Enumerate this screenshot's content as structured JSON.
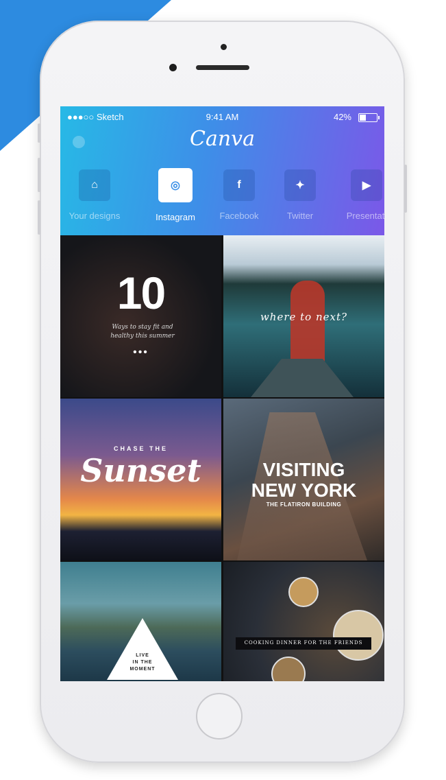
{
  "status_bar": {
    "carrier": "●●●○○ Sketch",
    "time": "9:41 AM",
    "battery": "42%",
    "battery_level": 0.42
  },
  "app": {
    "logo": "Canva"
  },
  "tabs": [
    {
      "label": "Your designs",
      "icon": "home-icon",
      "glyph": "⌂"
    },
    {
      "label": "Instagram",
      "icon": "instagram-icon",
      "glyph": "◎"
    },
    {
      "label": "Facebook",
      "icon": "facebook-icon",
      "glyph": "f"
    },
    {
      "label": "Twitter",
      "icon": "twitter-icon",
      "glyph": "✦"
    },
    {
      "label": "Presentati",
      "icon": "presentation-icon",
      "glyph": "▶"
    }
  ],
  "active_tab": "Instagram",
  "templates": {
    "fit": {
      "number": "10",
      "subtitle": "Ways to stay fit and healthy this summer",
      "dots": "•••"
    },
    "next": {
      "caption": "where to next?"
    },
    "sunset": {
      "top": "CHASE THE",
      "script": "Sunset"
    },
    "ny": {
      "line1": "VISITING",
      "line2": "NEW YORK",
      "line3": "THE FLATIRON BUILDING"
    },
    "moment": {
      "l1": "LIVE",
      "l2": "IN THE",
      "l3": "MOMENT"
    },
    "dinner": {
      "banner": "COOKING DINNER FOR THE FRIENDS"
    }
  },
  "colors": {
    "header_start": "#27b9e6",
    "header_end": "#7b58e8",
    "accent": "#2d8be0"
  }
}
